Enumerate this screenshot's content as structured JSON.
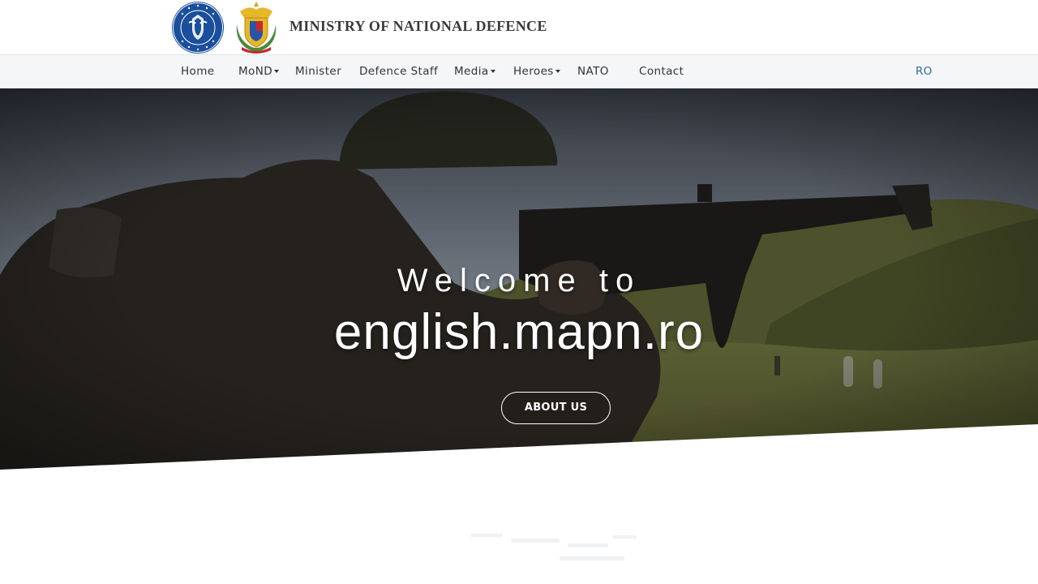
{
  "header": {
    "title": "MINISTRY OF NATIONAL DEFENCE",
    "logos": [
      "guvernul-romaniei-seal",
      "ministry-coat-of-arms"
    ]
  },
  "nav": {
    "items": [
      {
        "label": "Home"
      },
      {
        "label": "MoND",
        "dropdown": true
      },
      {
        "label": "Minister"
      },
      {
        "label": "Defence Staff"
      },
      {
        "label": "Media",
        "dropdown": true
      },
      {
        "label": "Heroes",
        "dropdown": true
      },
      {
        "label": "NATO"
      },
      {
        "label": "Contact"
      }
    ],
    "language": "RO"
  },
  "hero": {
    "welcome": "Welcome to",
    "domain": "english.mapn.ro",
    "button_label": "ABOUT US"
  },
  "colors": {
    "nav_background": "#f5f6f7",
    "language_link": "#2a6f97",
    "title_text": "#3a3a3a",
    "seal_blue": "#1b4f9c",
    "crest_gold": "#e5b82a"
  }
}
